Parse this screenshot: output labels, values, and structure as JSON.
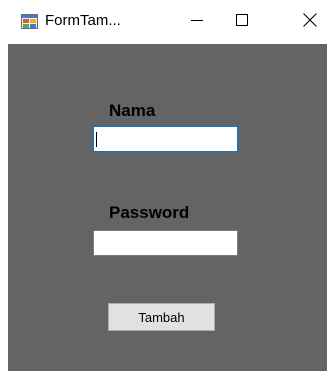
{
  "window": {
    "title": "FormTam...",
    "app_icon": "winforms-app-icon",
    "controls": {
      "minimize_icon": "minimize-icon",
      "maximize_icon": "maximize-icon",
      "close_icon": "close-icon"
    }
  },
  "form": {
    "background_color": "#646464",
    "nama": {
      "label": "Nama",
      "value": "",
      "focused": true
    },
    "password": {
      "label": "Password",
      "value": ""
    },
    "submit_button": {
      "label": "Tambah"
    }
  }
}
